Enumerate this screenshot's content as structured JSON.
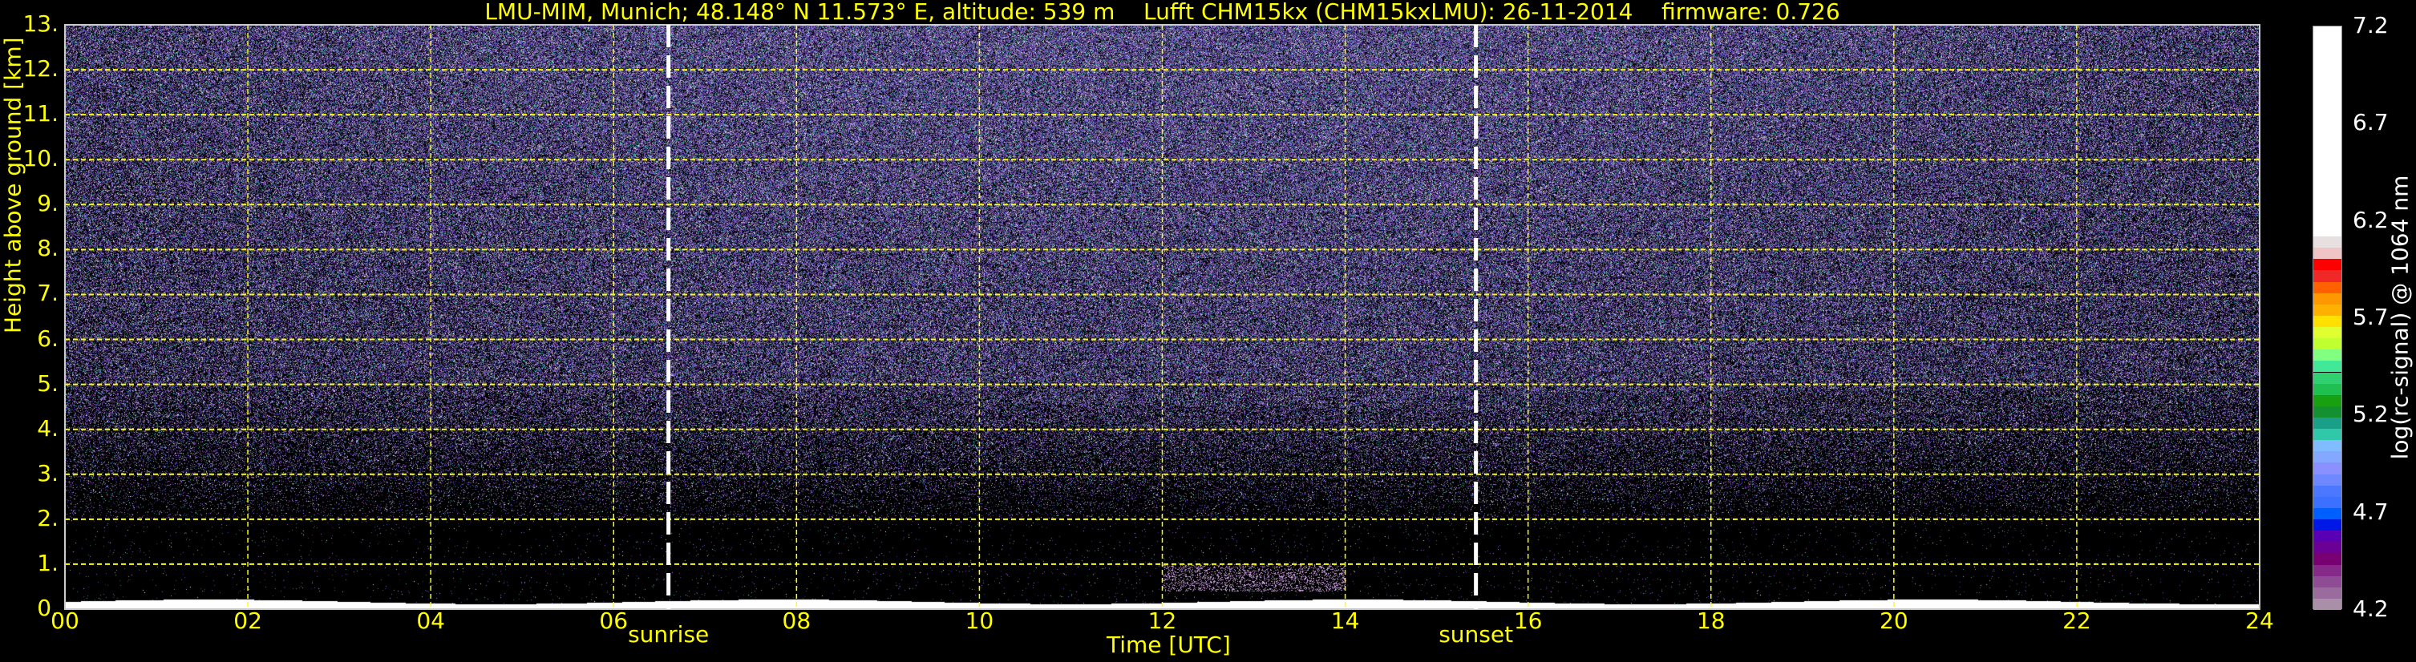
{
  "chart_data": {
    "type": "heatmap",
    "title": "LMU-MIM, Munich; 48.148° N 11.573° E, altitude: 539 m    Lufft CHM15kx (CHM15kxLMU): 26-11-2014    firmware: 0.726",
    "xlabel": "Time [UTC]",
    "ylabel": "Height above ground [km]",
    "xlim": [
      0,
      24
    ],
    "ylim": [
      0,
      13
    ],
    "x_ticks": [
      "00",
      "02",
      "04",
      "06",
      "08",
      "10",
      "12",
      "14",
      "16",
      "18",
      "20",
      "22",
      "24"
    ],
    "y_ticks": [
      "0.",
      "1.",
      "2.",
      "3.",
      "4.",
      "5.",
      "6.",
      "7.",
      "8.",
      "9.",
      "10.",
      "11.",
      "12.",
      "13."
    ],
    "grid": true,
    "annotations": [
      {
        "label": "sunrise",
        "x": 6.6
      },
      {
        "label": "sunset",
        "x": 15.43
      }
    ],
    "colorbar": {
      "label": "log(rc-signal) @ 1064 nm",
      "range": [
        4.2,
        7.2
      ],
      "ticks": [
        "4.2",
        "4.7",
        "5.2",
        "5.7",
        "6.2",
        "6.7",
        "7.2"
      ],
      "colors": [
        "#a990a8",
        "#9a6c9e",
        "#8e4c94",
        "#862a8a",
        "#780072",
        "#6a0096",
        "#5a00b4",
        "#0018e6",
        "#0060ff",
        "#3c70ff",
        "#4c78ff",
        "#6e88ff",
        "#8a90ff",
        "#84a8ff",
        "#80bcff",
        "#30c8a8",
        "#1aa088",
        "#159030",
        "#18a010",
        "#20c050",
        "#30d070",
        "#40e898",
        "#80ff80",
        "#c0ff30",
        "#e0ff30",
        "#ffe000",
        "#ffb000",
        "#ff9800",
        "#ff6000",
        "#f02828",
        "#ff0000",
        "#f0c4c4",
        "#e8e0e0",
        "#ffffff"
      ]
    }
  }
}
